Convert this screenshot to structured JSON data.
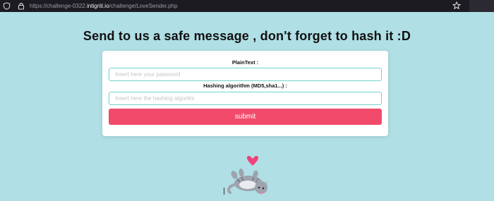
{
  "browser": {
    "url_prefix": "https://challenge-0322.",
    "url_host": "intigriti.io",
    "url_path": "/challenge/LoveSender.php"
  },
  "page": {
    "heading": "Send to us a safe message , don't forget to hash it :D"
  },
  "form": {
    "plaintext_label": "PlainText :",
    "plaintext_placeholder": "Insert here your password",
    "algorithm_label": "Hashing algorithm (MD5,sha1...) :",
    "algorithm_placeholder": "Insert here the hashing algoritm",
    "submit_label": "submit"
  },
  "colors": {
    "background": "#b0dfe5",
    "submit": "#f24a6b",
    "input_border": "#70d3c6"
  }
}
